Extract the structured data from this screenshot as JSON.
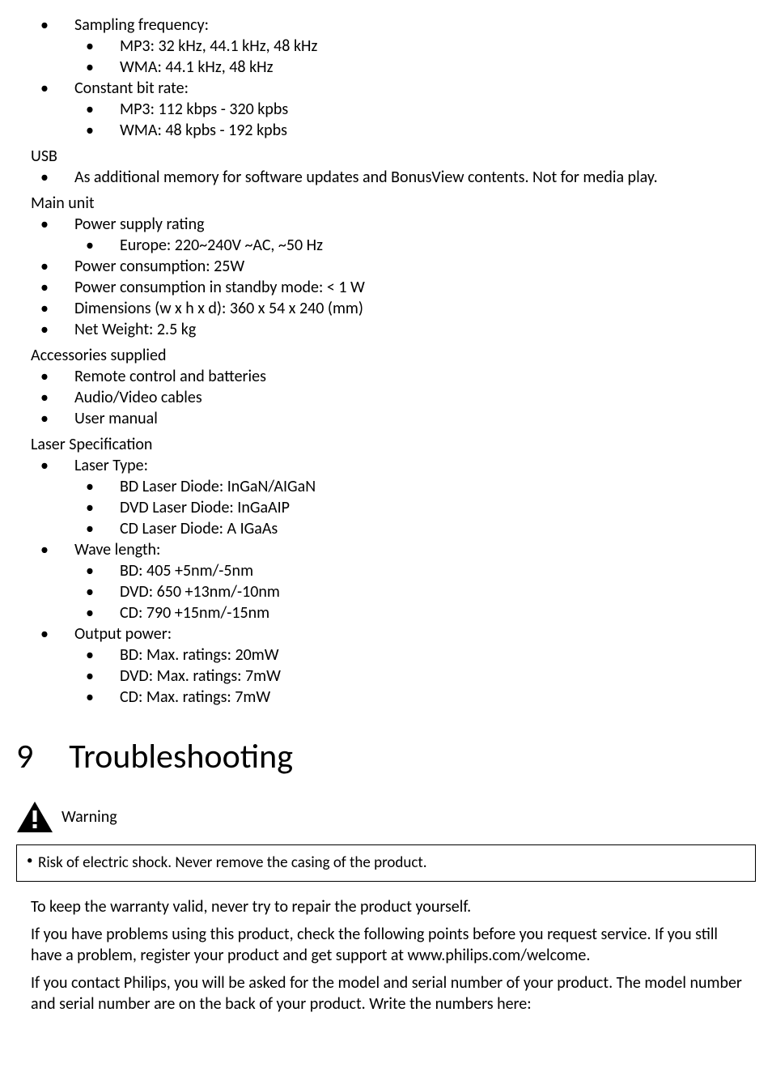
{
  "specs": {
    "sampling": {
      "label": "Sampling frequency:",
      "mp3": "MP3: 32 kHz, 44.1 kHz, 48 kHz",
      "wma": "WMA: 44.1 kHz, 48 kHz"
    },
    "cbr": {
      "label": "Constant bit rate:",
      "mp3": "MP3: 112 kbps - 320 kpbs",
      "wma": "WMA: 48 kpbs - 192 kpbs"
    }
  },
  "usb": {
    "heading": "USB",
    "line": "As additional memory for software updates and BonusView contents. Not for media play."
  },
  "mainunit": {
    "heading": "Main unit",
    "psr_label": "Power supply rating",
    "psr_eu": "Europe: 220~240V ~AC, ~50 Hz",
    "pc": "Power consumption: 25W",
    "pcs": "Power consumption in standby mode: < 1 W",
    "dim": "Dimensions (w x h x d): 360 x 54 x 240 (mm)",
    "nw": "Net Weight: 2.5 kg"
  },
  "acc": {
    "heading": "Accessories supplied",
    "r": "Remote control and batteries",
    "av": "Audio/Video cables",
    "um": "User manual"
  },
  "laser": {
    "heading": "Laser Specification",
    "type_label": "Laser Type:",
    "type_bd": "BD Laser Diode: InGaN/AIGaN",
    "type_dvd": "DVD Laser Diode: InGaAIP",
    "type_cd": "CD Laser Diode: A IGaAs",
    "wl_label": "Wave length:",
    "wl_bd": "BD: 405 +5nm/-5nm",
    "wl_dvd": "DVD: 650 +13nm/-10nm",
    "wl_cd": "CD: 790 +15nm/-15nm",
    "op_label": "Output power:",
    "op_bd": "BD: Max. ratings: 20mW",
    "op_dvd": "DVD: Max. ratings: 7mW",
    "op_cd": "CD: Max. ratings: 7mW"
  },
  "chapter": {
    "num": "9",
    "title": "Troubleshooting"
  },
  "warning": {
    "label": "Warning",
    "box": "Risk of electric shock. Never remove the casing of the product."
  },
  "para1": "To keep the warranty valid, never try to repair the product yourself.",
  "para2": "If you have problems using this product, check the following points before you request service. If you still have a problem, register your product and get support at www.philips.com/welcome.",
  "para3": "If you contact Philips, you will be asked for the model and serial number of your product. The model number and serial number are on the back of your product. Write the numbers here:"
}
